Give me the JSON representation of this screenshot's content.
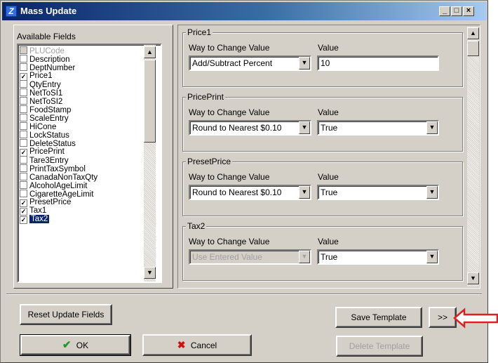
{
  "window": {
    "title": "Mass Update",
    "app_icon": "mass-update-app-icon"
  },
  "titlebar_buttons": {
    "minimize": "_",
    "maximize": "□",
    "close": "×"
  },
  "available_fields": {
    "label": "Available Fields",
    "items": [
      {
        "label": "PLUCode",
        "checked": false,
        "disabled": true
      },
      {
        "label": "Description",
        "checked": false
      },
      {
        "label": "DeptNumber",
        "checked": false
      },
      {
        "label": "Price1",
        "checked": true
      },
      {
        "label": "QtyEntry",
        "checked": false
      },
      {
        "label": "NetToSI1",
        "checked": false
      },
      {
        "label": "NetToSI2",
        "checked": false
      },
      {
        "label": "FoodStamp",
        "checked": false
      },
      {
        "label": "ScaleEntry",
        "checked": false
      },
      {
        "label": "HiCone",
        "checked": false
      },
      {
        "label": "LockStatus",
        "checked": false
      },
      {
        "label": "DeleteStatus",
        "checked": false
      },
      {
        "label": "PricePrint",
        "checked": true
      },
      {
        "label": "Tare3Entry",
        "checked": false
      },
      {
        "label": "PrintTaxSymbol",
        "checked": false
      },
      {
        "label": "CanadaNonTaxQty",
        "checked": false
      },
      {
        "label": "AlcoholAgeLimit",
        "checked": false
      },
      {
        "label": "CigaretteAgeLimit",
        "checked": false
      },
      {
        "label": "PresetPrice",
        "checked": true
      },
      {
        "label": "Tax1",
        "checked": true
      },
      {
        "label": "Tax2",
        "checked": true,
        "selected": true
      }
    ]
  },
  "groups": [
    {
      "title": "Price1",
      "way_label": "Way to Change Value",
      "value_label": "Value",
      "way": "Add/Subtract Percent",
      "value": "10",
      "value_type": "text",
      "way_disabled": false
    },
    {
      "title": "PricePrint",
      "way_label": "Way to Change Value",
      "value_label": "Value",
      "way": "Round to Nearest $0.10",
      "value": "True",
      "value_type": "combo",
      "way_disabled": false
    },
    {
      "title": "PresetPrice",
      "way_label": "Way to Change Value",
      "value_label": "Value",
      "way": "Round to Nearest $0.10",
      "value": "True",
      "value_type": "combo",
      "way_disabled": false
    },
    {
      "title": "Tax2",
      "way_label": "Way to Change Value",
      "value_label": "Value",
      "way": "Use Entered Value",
      "value": "True",
      "value_type": "combo",
      "way_disabled": true
    }
  ],
  "buttons": {
    "reset": "Reset Update Fields",
    "save_template": "Save Template",
    "more": ">>",
    "ok": "OK",
    "cancel": "Cancel",
    "delete_template": "Delete Template"
  },
  "annotation": {
    "arrow_color": "#e02020",
    "points_to": "more-button"
  },
  "colors": {
    "title_start": "#0a246a",
    "title_end": "#a6caf0",
    "face": "#d4d0c8",
    "selection": "#0a246a"
  }
}
